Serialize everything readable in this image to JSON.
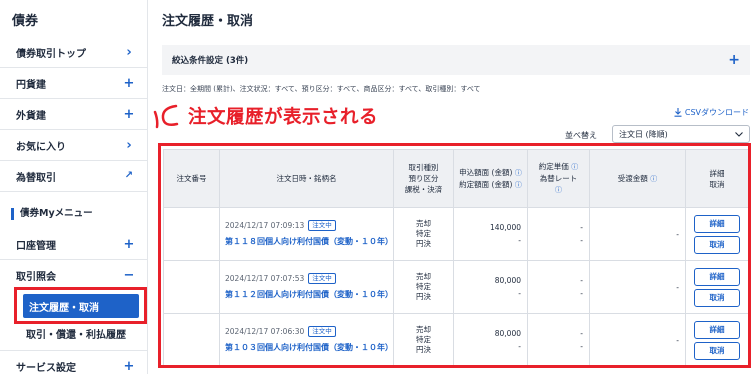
{
  "sidebar": {
    "title": "債券",
    "items": [
      {
        "label": "債券取引トップ",
        "symbol": "›"
      },
      {
        "label": "円貨建",
        "symbol": "+"
      },
      {
        "label": "外貨建",
        "symbol": "+"
      },
      {
        "label": "お気に入り",
        "symbol": "›"
      },
      {
        "label": "為替取引",
        "symbol": "↗"
      }
    ],
    "section_title": "債券Myメニュー",
    "menu_items": [
      {
        "label": "口座管理",
        "symbol": "+"
      },
      {
        "label": "取引照会",
        "symbol": "−"
      }
    ],
    "active_item": "注文履歴・取消",
    "sub_item": "取引・償還・利払履歴",
    "bottom_item": {
      "label": "サービス設定",
      "symbol": "+"
    }
  },
  "main": {
    "title": "注文履歴・取消",
    "filter_bar_label": "絞込条件設定 (3件)",
    "filter_summary": "注文日：全期間 (累計)、注文状況：すべて、預り区分：すべて、商品区分：すべて、取引種別：すべて",
    "annotation": "注文履歴が表示される",
    "csv_link": "CSVダウンロード",
    "sort_label": "並べ替え",
    "sort_value": "注文日 (降順)"
  },
  "table": {
    "headers": {
      "order_no": "注文番号",
      "datetime_name": "注文日時・銘柄名",
      "category": [
        "取引種別",
        "預り区分",
        "課税・決済"
      ],
      "amount": [
        "申込額面 (金額)",
        "約定額面 (金額)"
      ],
      "price": [
        "約定単価",
        "為替レート"
      ],
      "delivery": "受渡金額",
      "detail_cancel": [
        "詳細",
        "取消"
      ]
    },
    "rows": [
      {
        "order_no": "",
        "datetime": "2024/12/17 07:09:13",
        "status": "注文中",
        "name": "第１１８回個人向け利付国債（変動・１０年）",
        "category": [
          "売却",
          "特定",
          "円決"
        ],
        "amount_applied": "140,000",
        "amount_executed": "-",
        "price": "-",
        "fx_rate": "-",
        "delivery": "-",
        "detail": "詳細",
        "cancel": "取消"
      },
      {
        "order_no": "",
        "datetime": "2024/12/17 07:07:53",
        "status": "注文中",
        "name": "第１１２回個人向け利付国債（変動・１０年）",
        "category": [
          "売却",
          "特定",
          "円決"
        ],
        "amount_applied": "80,000",
        "amount_executed": "-",
        "price": "-",
        "fx_rate": "-",
        "delivery": "-",
        "detail": "詳細",
        "cancel": "取消"
      },
      {
        "order_no": "",
        "datetime": "2024/12/17 07:06:30",
        "status": "注文中",
        "name": "第１０３回個人向け利付国債（変動・１０年）",
        "category": [
          "売却",
          "特定",
          "円決"
        ],
        "amount_applied": "80,000",
        "amount_executed": "-",
        "price": "-",
        "fx_rate": "-",
        "delivery": "-",
        "detail": "詳細",
        "cancel": "取消"
      }
    ]
  },
  "colors": {
    "accent": "#1e62c8",
    "highlight": "#e8202a",
    "header_bg": "#eef0f3"
  }
}
